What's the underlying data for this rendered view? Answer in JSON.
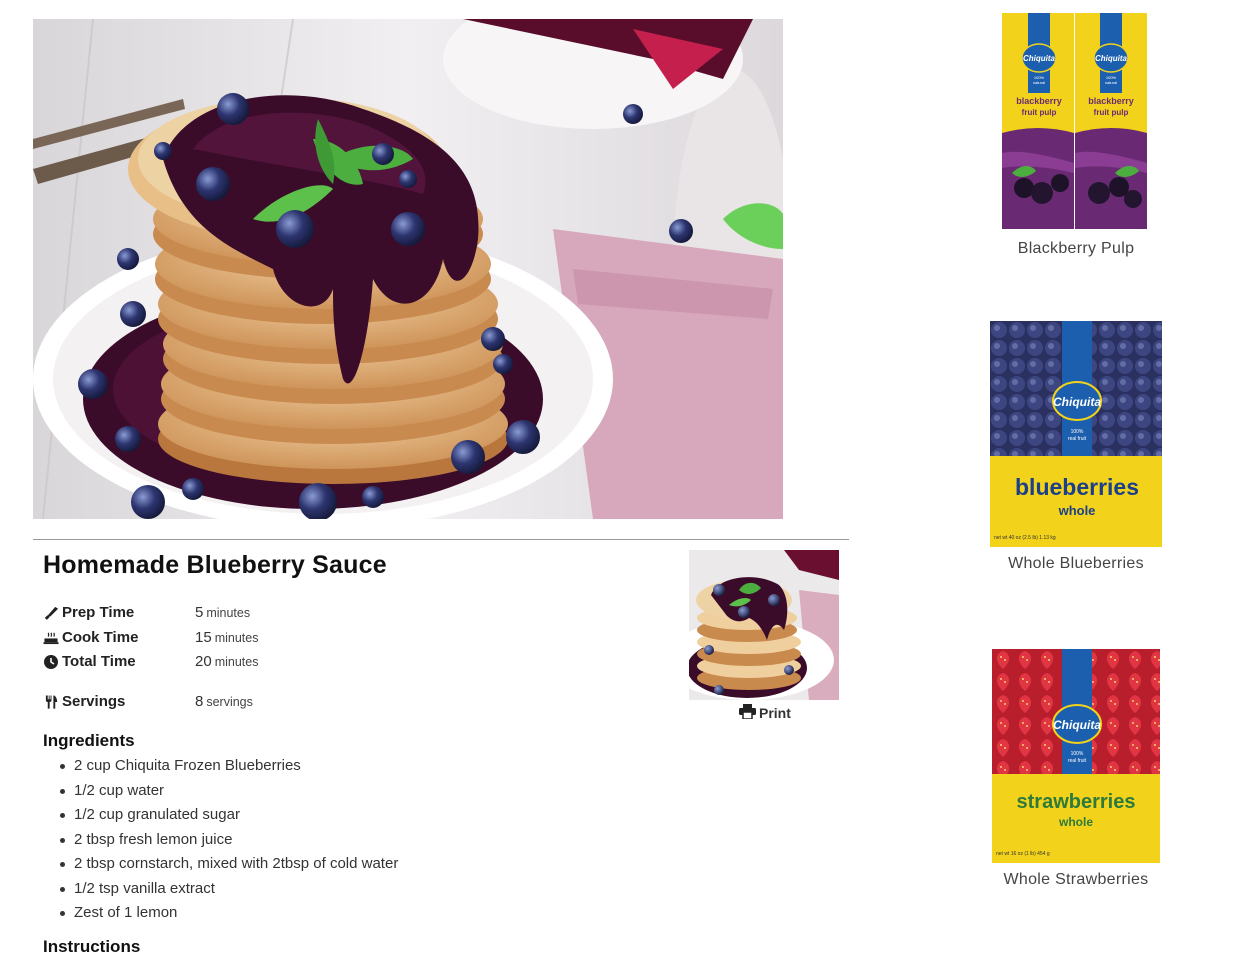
{
  "recipe": {
    "title": "Homemade Blueberry Sauce",
    "prep": {
      "label": "Prep Time",
      "value": "5",
      "unit": "minutes"
    },
    "cook": {
      "label": "Cook Time",
      "value": "15",
      "unit": "minutes"
    },
    "total": {
      "label": "Total Time",
      "value": "20",
      "unit": "minutes"
    },
    "servings": {
      "label": "Servings",
      "value": "8",
      "unit": "servings"
    },
    "ingredients_heading": "Ingredients",
    "ingredients": [
      "2 cup Chiquita Frozen Blueberries",
      "1/2 cup water",
      "1/2 cup granulated sugar",
      "2 tbsp fresh lemon juice",
      "2 tbsp cornstarch, mixed with 2tbsp of cold water",
      "1/2 tsp vanilla extract",
      "Zest of 1 lemon"
    ],
    "instructions_heading": "Instructions",
    "print_label": "Print"
  },
  "sidebar": {
    "products": [
      {
        "caption": "Blackberry Pulp",
        "brand": "Chiquita",
        "pack_text": "blackberry",
        "pack_sub": "fruit pulp",
        "pack_badge": "100% natural"
      },
      {
        "caption": "Whole Blueberries",
        "brand": "Chiquita",
        "pack_text": "blueberries",
        "pack_sub": "whole",
        "pack_badge": "100% real fruit"
      },
      {
        "caption": "Whole Strawberries",
        "brand": "Chiquita",
        "pack_text": "strawberries",
        "pack_sub": "whole",
        "pack_badge": "100% real fruit"
      }
    ]
  },
  "colors": {
    "pack_yellow": "#f2d21b",
    "brand_blue": "#1c5fae",
    "blackberry_purple": "#6a2a73",
    "blueberry_navy": "#27346b",
    "strawberry_red": "#d42a35",
    "sauce": "#3b0c2a"
  },
  "icons": {
    "prep": "knife-icon",
    "cook": "pot-icon",
    "total": "clock-icon",
    "servings": "utensils-icon",
    "print": "printer-icon"
  }
}
